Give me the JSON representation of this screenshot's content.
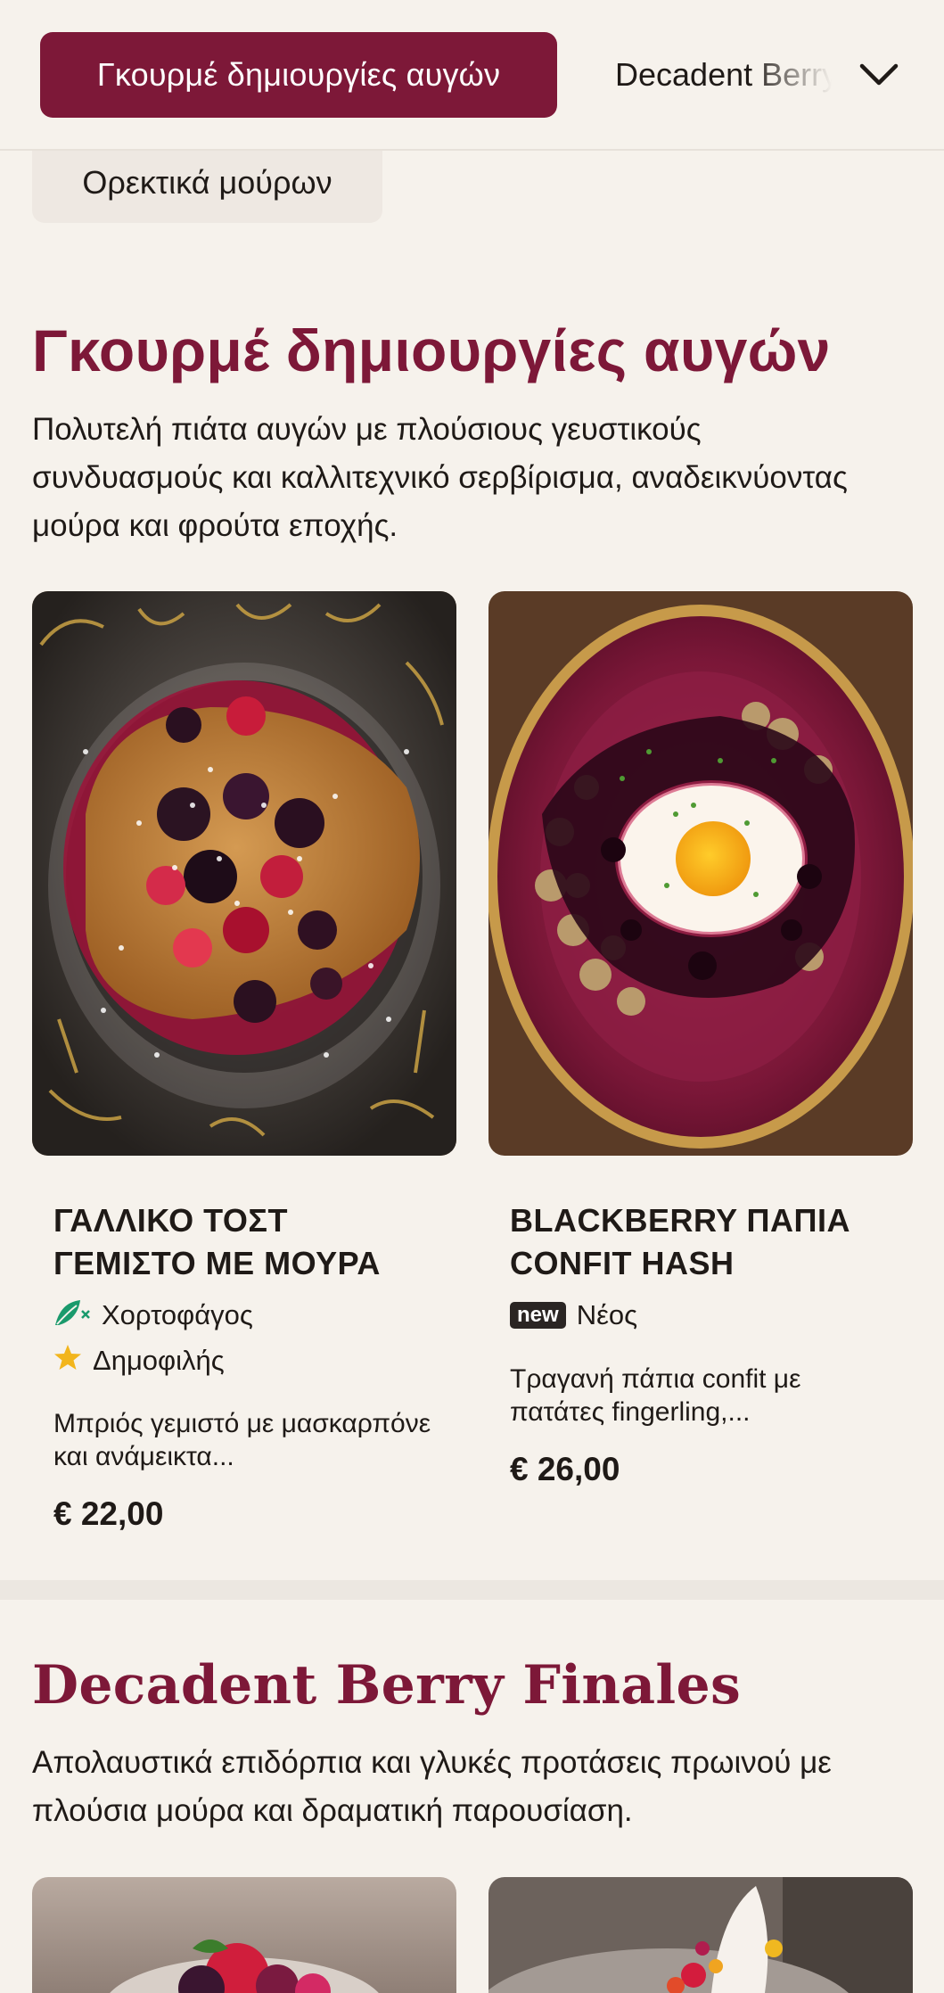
{
  "nav": {
    "active_category": "Γκουρμέ δημιουργίες αυγών",
    "next_category": "Decadent Berry Finales",
    "more_icon": "chevron-down-icon"
  },
  "sub_category": "Ορεκτικά μούρων",
  "section1": {
    "title": "Γκουρμέ δημιουργίες αυγών",
    "description": "Πολυτελή πιάτα αυγών με πλούσιους γευστικούς συνδυασμούς και καλλιτεχνικό σερβίρισμα, αναδεικνύοντας μούρα και φρούτα εποχής.",
    "items": [
      {
        "name": "ΓΑΛΛΙΚΟ ΤΟΣΤ ΓΕΜΙΣΤΟ ΜΕ ΜΟΥΡΑ",
        "tags": [
          {
            "icon": "vegetarian-leaf-icon",
            "label": "Χορτοφάγος"
          },
          {
            "icon": "star-icon",
            "label": "Δημοφιλής"
          }
        ],
        "description": "Μπριός γεμιστό με μασκαρπόνε και ανάμεικτα...",
        "price": "€ 22,00"
      },
      {
        "name": "BLACKBERRY ΠΑΠΙΑ CONFIT HASH",
        "tags": [
          {
            "icon": "new-badge",
            "badge": "new",
            "label": "Νέος"
          }
        ],
        "description": "Τραγανή πάπια confit με πατάτες fingerling,...",
        "price": "€ 26,00"
      }
    ]
  },
  "section2": {
    "title": "Decadent Berry Finales",
    "description": "Απολαυστικά επιδόρπια και γλυκές προτάσεις πρωινού με πλούσια μούρα και δραματική παρουσίαση."
  },
  "colors": {
    "accent": "#7d1838",
    "background": "#f6f2ec",
    "text": "#1f1a17",
    "vegetarian": "#1a9a6c",
    "star": "#f2b51c"
  }
}
